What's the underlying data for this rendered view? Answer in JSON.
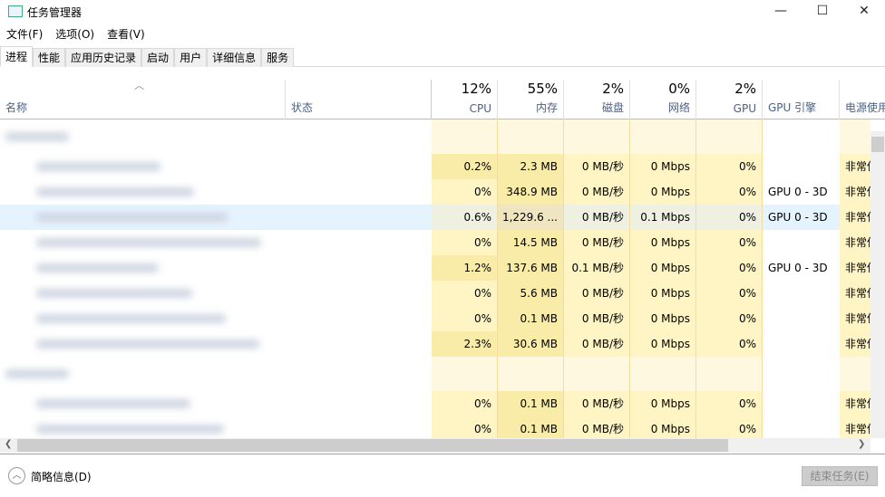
{
  "window": {
    "title": "任务管理器",
    "minimize": "—",
    "maximize": "☐",
    "close": "✕"
  },
  "menu": [
    "文件(F)",
    "选项(O)",
    "查看(V)"
  ],
  "tabs": [
    "进程",
    "性能",
    "应用历史记录",
    "启动",
    "用户",
    "详细信息",
    "服务"
  ],
  "header": {
    "name": "名称",
    "status": "状态",
    "cpu_pct": "12%",
    "cpu": "CPU",
    "mem_pct": "55%",
    "mem": "内存",
    "disk_pct": "2%",
    "disk": "磁盘",
    "net_pct": "0%",
    "net": "网络",
    "gpu_pct": "2%",
    "gpu": "GPU",
    "gpu_engine": "GPU 引擎",
    "power": "电源使用"
  },
  "rows": [
    {
      "group": true
    },
    {
      "cpu": "0.2%",
      "mem": "2.3 MB",
      "disk": "0 MB/秒",
      "net": "0 Mbps",
      "gpu": "0%",
      "engine": "",
      "power": "非常低",
      "hot": true
    },
    {
      "cpu": "0%",
      "mem": "348.9 MB",
      "disk": "0 MB/秒",
      "net": "0 Mbps",
      "gpu": "0%",
      "engine": "GPU 0 - 3D",
      "power": "非常低"
    },
    {
      "cpu": "0.6%",
      "mem": "1,229.6 ...",
      "disk": "0 MB/秒",
      "net": "0.1 Mbps",
      "gpu": "0%",
      "engine": "GPU 0 - 3D",
      "power": "非常低",
      "selected": true
    },
    {
      "cpu": "0%",
      "mem": "14.5 MB",
      "disk": "0 MB/秒",
      "net": "0 Mbps",
      "gpu": "0%",
      "engine": "",
      "power": "非常低"
    },
    {
      "cpu": "1.2%",
      "mem": "137.6 MB",
      "disk": "0.1 MB/秒",
      "net": "0 Mbps",
      "gpu": "0%",
      "engine": "GPU 0 - 3D",
      "power": "非常低",
      "hot": true
    },
    {
      "cpu": "0%",
      "mem": "5.6 MB",
      "disk": "0 MB/秒",
      "net": "0 Mbps",
      "gpu": "0%",
      "engine": "",
      "power": "非常低"
    },
    {
      "cpu": "0%",
      "mem": "0.1 MB",
      "disk": "0 MB/秒",
      "net": "0 Mbps",
      "gpu": "0%",
      "engine": "",
      "power": "非常低"
    },
    {
      "cpu": "2.3%",
      "mem": "30.6 MB",
      "disk": "0 MB/秒",
      "net": "0 Mbps",
      "gpu": "0%",
      "engine": "",
      "power": "非常低",
      "hot": true
    },
    {
      "group": true
    },
    {
      "cpu": "0%",
      "mem": "0.1 MB",
      "disk": "0 MB/秒",
      "net": "0 Mbps",
      "gpu": "0%",
      "engine": "",
      "power": "非常低"
    },
    {
      "cpu": "0%",
      "mem": "0.1 MB",
      "disk": "0 MB/秒",
      "net": "0 Mbps",
      "gpu": "0%",
      "engine": "",
      "power": "非常低"
    }
  ],
  "footer": {
    "fewer_details": "简略信息(D)",
    "end_task": "结束任务(E)"
  },
  "colors": {
    "cell": "#fff4c4",
    "cell_hot": "#f9eca8",
    "group": "#fff8e1",
    "selected": "#e5f3ff"
  }
}
